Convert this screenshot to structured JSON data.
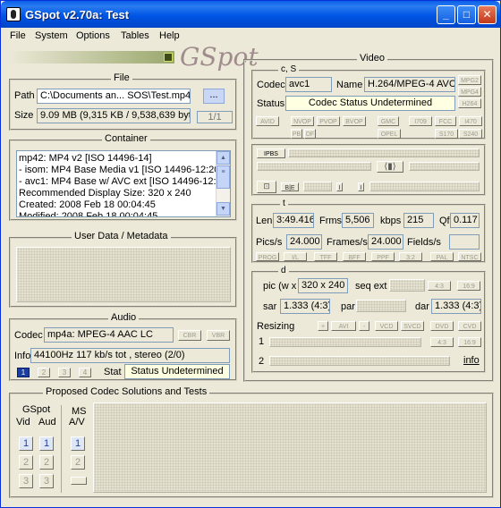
{
  "window": {
    "title": "GSpot v2.70a: Test"
  },
  "menu": [
    "File",
    "System",
    "Options",
    "Tables",
    "Help"
  ],
  "logo": {
    "text": "GSpot"
  },
  "file": {
    "legend": "File",
    "path_label": "Path",
    "path_value": "C:\\Documents an... SOS\\Test.mp4",
    "browse": "...",
    "size_label": "Size",
    "size_value": "9.09 MB (9,315 KB / 9,538,639 byt",
    "counter": "1/1"
  },
  "container": {
    "legend": "Container",
    "lines": [
      "mp42: MP4 v2 [ISO 14496-14]",
      "- isom: MP4  Base Media v1 [ISO 14496-12:20",
      "- avc1: MP4 Base w/ AVC ext [ISO 14496-12:",
      "Recommended Display Size: 320 x 240",
      "Created:     2008 Feb 18  00:04:45",
      "Modified:    2008 Feb 18  00:04:45"
    ]
  },
  "user_data": {
    "legend": "User Data / Metadata"
  },
  "audio": {
    "legend": "Audio",
    "codec_label": "Codec",
    "codec_value": "mp4a: MPEG-4 AAC LC",
    "cbr": "CBR",
    "vbr": "VBR",
    "info_label": "Info",
    "info_value": "44100Hz  117 kb/s tot , stereo (2/0)",
    "streams": [
      "1",
      "2",
      "3",
      "4"
    ],
    "stat_label": "Stat",
    "stat_value": "Status Undetermined"
  },
  "proposed": {
    "legend": "Proposed Codec Solutions and Tests",
    "gspot": "GSpot",
    "vid": "Vid",
    "aud": "Aud",
    "ms": "MS",
    "av": "A/V",
    "vid_btns": [
      "1",
      "2",
      "3"
    ],
    "aud_btns": [
      "1",
      "2",
      "3"
    ],
    "ms_btns": [
      "1",
      "2"
    ]
  },
  "video": {
    "legend": "Video",
    "cs_legend": "c, S",
    "codec_label": "Codec",
    "codec_value": "avc1",
    "name_label": "Name",
    "name_value": "H.264/MPEG-4 AVC",
    "fmt_btns": [
      "MPG2",
      "MPG4",
      "H264"
    ],
    "status_label": "Status",
    "status_value": "Codec Status Undetermined",
    "row_btns": [
      "AVID",
      "NVOP",
      "PVOP",
      "BVOP",
      "GMC",
      "I709",
      "FCC",
      "I470",
      "PB",
      "DF",
      "OPEL",
      "S170",
      "S240"
    ],
    "ipbs": "IPBS",
    "t_legend": "t",
    "len_label": "Len",
    "len_value": "3:49.416",
    "frms_label": "Frms",
    "frms_value": "5,506",
    "kbps_label": "kbps",
    "kbps_value": "215",
    "qf_label": "Qf",
    "qf_value": "0.117",
    "pics_label": "Pics/s",
    "pics_value": "24.000",
    "frames_label": "Frames/s",
    "frames_value": "24.000",
    "fields_label": "Fields/s",
    "fields_value": "",
    "pulldown_btns": [
      "PROG",
      "I/L",
      "TFF",
      "BFF",
      "PPF",
      "3:2",
      "PAL",
      "NTSC"
    ],
    "d_legend": "d",
    "pic_label": "pic (w x",
    "pic_value": "320 x 240",
    "seq_label": "seq ext",
    "seq_value": "",
    "ar_btns": [
      "4:3",
      "16:9"
    ],
    "sar_label": "sar",
    "sar_value": "1.333 (4:3)",
    "par_label": "par",
    "par_value": "",
    "dar_label": "dar",
    "dar_value": "1.333 (4:3)",
    "resizing_label": "Resizing",
    "resize_btns": [
      "+",
      "AVI",
      "-",
      "VCD",
      "SVCD",
      "DVD",
      "CVD"
    ],
    "row1": "1",
    "row2": "2",
    "ar_btns2": [
      "4:3",
      "16:9"
    ],
    "info_link": "info"
  }
}
